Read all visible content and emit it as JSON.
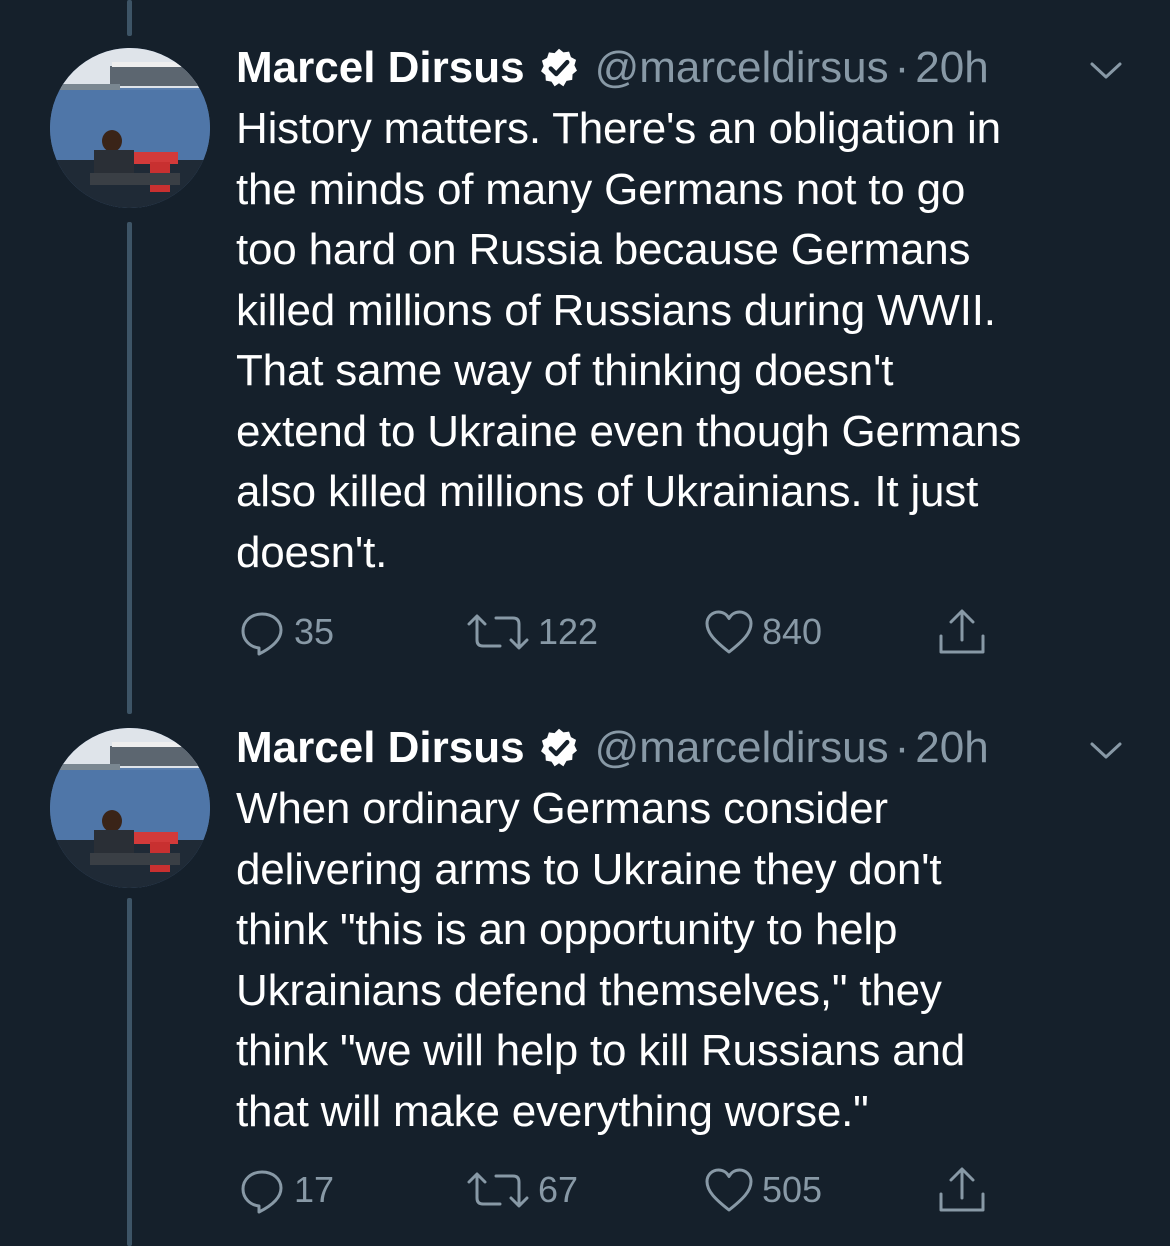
{
  "tweets": [
    {
      "display_name": "Marcel Dirsus",
      "handle": "@marceldirsus",
      "separator": "·",
      "time": "20h",
      "lines": [
        "History matters. There's an obligation in",
        "the minds of many Germans not to go",
        "too hard on Russia because Germans",
        "killed millions of Russians during WWII.",
        "That same way of thinking doesn't",
        "extend to Ukraine even though Germans",
        "also killed millions of Ukrainians. It just",
        "doesn't."
      ],
      "replies": "35",
      "retweets": "122",
      "likes": "840"
    },
    {
      "display_name": "Marcel Dirsus",
      "handle": "@marceldirsus",
      "separator": "·",
      "time": "20h",
      "lines": [
        "When ordinary Germans consider",
        "delivering arms to Ukraine they don't",
        "think \"this is an opportunity to help",
        "Ukrainians defend themselves,\" they",
        "think \"we will help to kill Russians and",
        "that will make everything worse.\""
      ],
      "replies": "17",
      "retweets": "67",
      "likes": "505"
    }
  ],
  "icons": {
    "verified": "verified-badge-icon",
    "caret": "chevron-down-icon",
    "reply": "reply-icon",
    "retweet": "retweet-icon",
    "like": "heart-icon",
    "share": "share-icon"
  },
  "colors": {
    "background": "#15202b",
    "text": "#ffffff",
    "secondary": "#8899a6",
    "thread_line": "#3d5466"
  }
}
